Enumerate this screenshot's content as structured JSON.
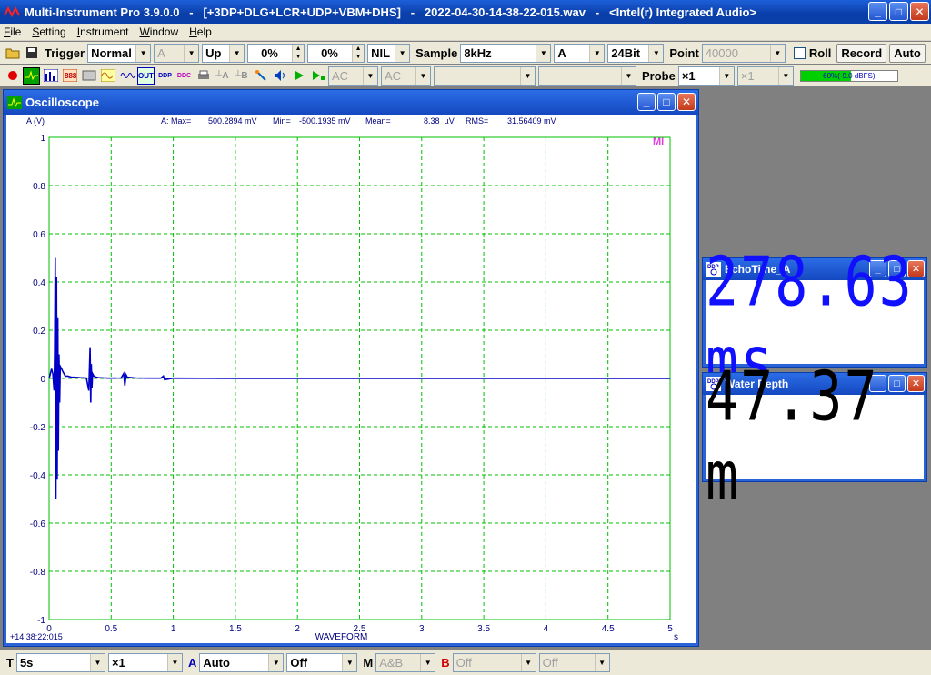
{
  "window": {
    "title": "Multi-Instrument Pro 3.9.0.0   -   [+3DP+DLG+LCR+UDP+VBM+DHS]   -   2022-04-30-14-38-22-015.wav   -   <Intel(r) Integrated Audio>"
  },
  "menu": [
    "File",
    "Setting",
    "Instrument",
    "Window",
    "Help"
  ],
  "toolbar1": {
    "trigger_label": "Trigger",
    "trigger_mode": "Normal",
    "trigger_channel": "A",
    "trigger_edge": "Up",
    "trigger_level": "0%",
    "trigger_delay": "0%",
    "window_func": "NIL",
    "sample_label": "Sample",
    "sample_rate": "8kHz",
    "input_channel": "A",
    "bit_depth": "24Bit",
    "point_label": "Point",
    "point_value": "40000",
    "roll_label": "Roll",
    "record_label": "Record",
    "auto_label": "Auto"
  },
  "toolbar2": {
    "icon_labels": [
      "DDP",
      "OUT",
      "DDP",
      "DDC"
    ],
    "coupling_a": "AC",
    "coupling_b": "AC",
    "probe_label": "Probe",
    "probe_a": "×1",
    "probe_b": "×1",
    "level_meter_text": "60%(-9.0 dBFS)",
    "level_meter_fraction": 0.52
  },
  "oscilloscope": {
    "title": "Oscilloscope",
    "stats": {
      "label": "A: Max=",
      "max": "500.2894 mV",
      "min_label": "Min=",
      "min": "-500.1935 mV",
      "mean_label": "Mean=",
      "mean": "8.38  µV",
      "rms_label": "RMS=",
      "rms": "31.56409 mV"
    },
    "logo": "MI",
    "timestamp": "+14:38:22:015"
  },
  "chart_data": {
    "type": "line",
    "ylabel": "A (V)",
    "xlabel": "WAVEFORM",
    "xunit": "s",
    "xlim": [
      0,
      5
    ],
    "ylim": [
      -1,
      1
    ],
    "x_ticks": [
      "0",
      "0.5",
      "1",
      "1.5",
      "2",
      "2.5",
      "3",
      "3.5",
      "4",
      "4.5",
      "5"
    ],
    "y_ticks": [
      "1",
      "0.8",
      "0.6",
      "0.4",
      "0.2",
      "0",
      "-0.2",
      "-0.4",
      "-0.6",
      "-0.8",
      "-1"
    ],
    "grid": true,
    "series": [
      {
        "color": "#0000c8",
        "x": [
          0,
          0.01,
          0.02,
          0.03,
          0.04,
          0.045,
          0.05,
          0.055,
          0.06,
          0.065,
          0.07,
          0.075,
          0.08,
          0.085,
          0.09,
          0.1,
          0.11,
          0.12,
          0.13,
          0.15,
          0.18,
          0.2,
          0.25,
          0.3,
          0.32,
          0.33,
          0.335,
          0.34,
          0.345,
          0.35,
          0.36,
          0.38,
          0.4,
          0.45,
          0.5,
          0.58,
          0.6,
          0.61,
          0.62,
          0.63,
          0.7,
          0.8,
          0.9,
          0.92,
          0.93,
          1.0,
          1.5,
          2.0,
          2.5,
          3.0,
          3.5,
          4.0,
          4.5,
          5.0
        ],
        "y": [
          0,
          0.02,
          0.04,
          0.02,
          -0.05,
          0.1,
          0.5,
          -0.5,
          0.42,
          -0.42,
          0.25,
          -0.3,
          0.1,
          -0.1,
          0.05,
          0.04,
          0.03,
          0.02,
          0.01,
          0.01,
          0.005,
          0.005,
          0.003,
          0.002,
          -0.05,
          0.13,
          -0.1,
          0.06,
          -0.04,
          0.02,
          0.01,
          0.005,
          0.003,
          0.002,
          0.001,
          0.002,
          0.02,
          -0.03,
          0.015,
          0.005,
          0.002,
          0.001,
          0.001,
          0.01,
          -0.005,
          0.001,
          0,
          0,
          0,
          0,
          0,
          0,
          0,
          0
        ]
      }
    ]
  },
  "echo_time": {
    "title": "EchoTime_A",
    "value": "278.63 ms"
  },
  "water_depth": {
    "title": "Water Depth",
    "value": "47.37 m"
  },
  "statusbar": {
    "t_label": "T",
    "time_span": "5s",
    "zoom": "×1",
    "a_label": "A",
    "a_range": "Auto",
    "a_offset": "Off",
    "m_label": "M",
    "m_mode": "A&B",
    "b_label": "B",
    "b_range": "Off",
    "b_offset": "Off"
  },
  "colors": {
    "title_blue": "#0a3ea8",
    "trace": "#0000c8",
    "grid": "#00c000",
    "echo_value": "#1010ff"
  }
}
